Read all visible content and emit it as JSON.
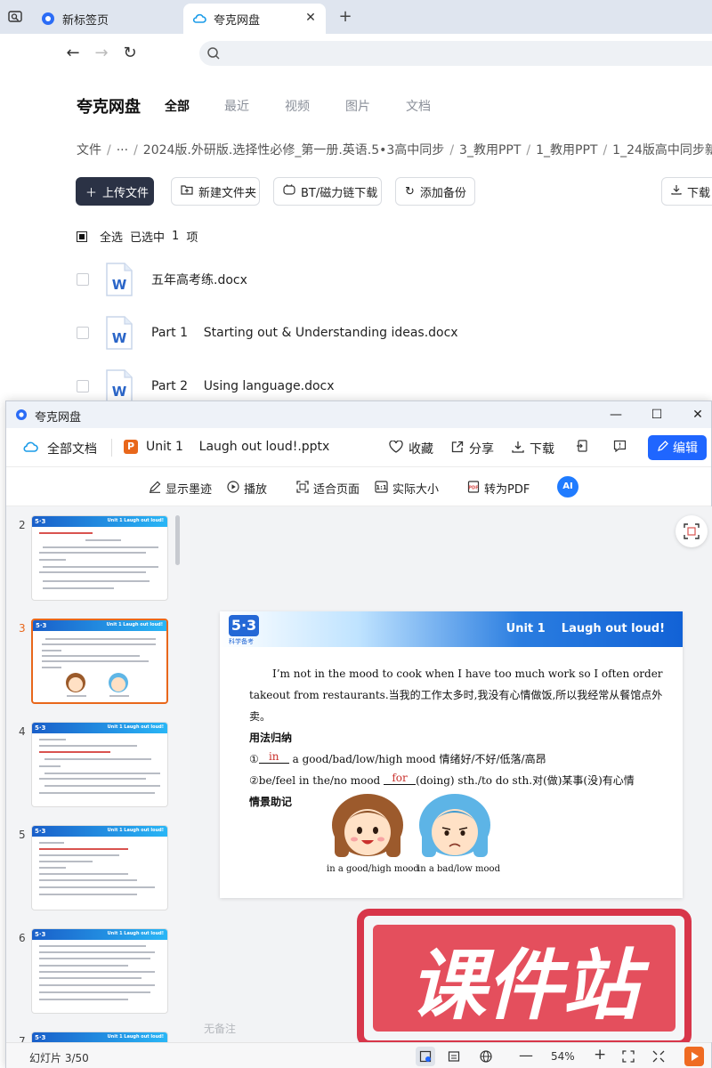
{
  "browser": {
    "tabs": [
      {
        "title": "新标签页",
        "active": false
      },
      {
        "title": "夸克网盘",
        "active": true
      }
    ]
  },
  "drive": {
    "brand": "夸克网盘",
    "nav_tabs": [
      "全部",
      "最近",
      "视频",
      "图片",
      "文档"
    ],
    "breadcrumb": [
      "文件",
      "···",
      "2024版.外研版.选择性必修_第一册.英语.5•3高中同步",
      "3_教用PPT",
      "1_教用PPT",
      "1_24版高中同步新"
    ],
    "actions": {
      "upload": "上传文件",
      "new_folder": "新建文件夹",
      "bt": "BT/磁力链下载",
      "backup": "添加备份",
      "download": "下载"
    },
    "selection": {
      "select_all": "全选",
      "selected_prefix": "已选中",
      "selected_count": "1",
      "selected_suffix": "项"
    },
    "files": [
      {
        "name": "五年高考练.docx"
      },
      {
        "name": "Part 1    Starting out & Understanding ideas.docx"
      },
      {
        "name": "Part 2    Using language.docx"
      }
    ]
  },
  "viewer": {
    "window_title": "夸克网盘",
    "all_docs": "全部文档",
    "file_name": "Unit 1    Laugh out loud!.pptx",
    "actions": {
      "favorite": "收藏",
      "share": "分享",
      "download": "下载",
      "edit": "编辑"
    },
    "toolbar2": {
      "ink": "显示墨迹",
      "play": "播放",
      "fit_page": "适合页面",
      "actual_size": "实际大小",
      "to_pdf": "转为PDF",
      "ai": "AI"
    },
    "thumbnails": [
      {
        "num": "2",
        "active": false
      },
      {
        "num": "3",
        "active": true
      },
      {
        "num": "4",
        "active": false
      },
      {
        "num": "5",
        "active": false
      },
      {
        "num": "6",
        "active": false
      },
      {
        "num": "7",
        "active": false
      }
    ],
    "thumb_header": {
      "logo": "5·3",
      "unit": "Unit 1   Laugh out loud!"
    },
    "slide": {
      "logo": "5·3",
      "logo_sub": "科学备考",
      "unit": "Unit 1    Laugh out loud!",
      "para": "I’m not in the mood to cook when I have too much work so I often order takeout from restaurants.当我的工作太多时,我没有心情做饭,所以我经常从餐馆点外卖。",
      "usage_heading": "用法归纳",
      "item1_prefix": "①",
      "item1_blank": "in",
      "item1_text": "a good/bad/low/high mood 情绪好/不好/低落/高昂",
      "item2_prefix": "②be/feel in the/no mood",
      "item2_blank": "for",
      "item2_text": "(doing) sth./to do sth.对(做)某事(没)有心情",
      "scene_heading": "情景助记",
      "caption_good": "in a good/high mood",
      "caption_bad": "in a bad/low mood"
    },
    "notes": "无备注",
    "status": {
      "slide_counter": "幻灯片 3/50",
      "zoom": "54%"
    },
    "watermark": "课件站"
  }
}
